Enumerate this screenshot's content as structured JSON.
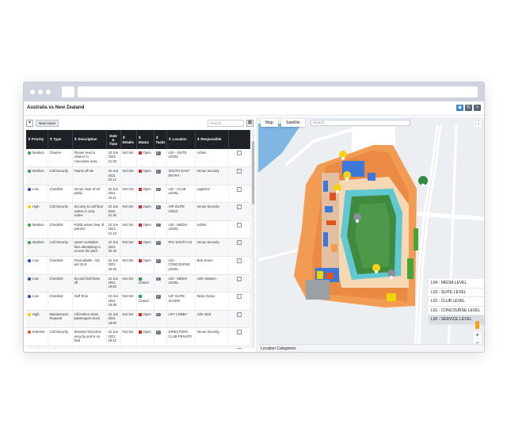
{
  "page": {
    "title": "Australia vs New Zealand"
  },
  "toolbar": {
    "filter_icon": "filter-icon",
    "new_issue_label": "New Issue",
    "search_placeholder": "Search"
  },
  "table": {
    "headers": [
      "Priority",
      "Type",
      "Description",
      "Date & Time",
      "Details",
      "Status",
      "Tasks",
      "Location",
      "Responsible"
    ],
    "rows": [
      {
        "priority": "Medium",
        "pcolor": "#2ea44f",
        "type": "Cleaner",
        "description": "Please send a cleaner to concourse area.",
        "datetime": "23 Jun 2021 21:20",
        "details": "Not Set",
        "status": "Open",
        "scolor": "#d62b2b",
        "tasks": "0",
        "location": "L03 - SUITE LEVEL",
        "responsible": "Admin"
      },
      {
        "priority": "Medium",
        "pcolor": "#2ea44f",
        "type": "Call Security",
        "description": "Teams off ele",
        "datetime": "22 Jun 2021 22:11",
        "details": "Not Set",
        "status": "Open",
        "scolor": "#d62b2b",
        "tasks": "0",
        "location": "SOUTH EAST ENTRY",
        "responsible": "Venue Security"
      },
      {
        "priority": "Low",
        "pcolor": "#2346c8",
        "type": "Checklist",
        "description": "Venue clear of all public",
        "datetime": "22 Jun 2021 22:11",
        "details": "Not Set",
        "status": "Open",
        "scolor": "#d62b2b",
        "tasks": "0",
        "location": "L02 - CLUB LEVEL",
        "responsible": "Logistics"
      },
      {
        "priority": "High",
        "pcolor": "#f0d400",
        "type": "Call Security",
        "description": "Security to call final orders in corp. suites",
        "datetime": "22 Jun 2021 21:30",
        "details": "Not Set",
        "status": "Open",
        "scolor": "#d62b2b",
        "tasks": "0",
        "location": "AIR SUITE GOLD",
        "responsible": "Venue Security"
      },
      {
        "priority": "Medium",
        "pcolor": "#2ea44f",
        "type": "Checklist",
        "description": "Public areas clear of patrons",
        "datetime": "22 Jun 2021 21:10",
        "details": "Not Set",
        "status": "Open",
        "scolor": "#d62b2b",
        "tasks": "0",
        "location": "L04 - MEDIA LEVEL",
        "responsible": "Admin"
      },
      {
        "priority": "Medium",
        "pcolor": "#2ea44f",
        "type": "Call Security",
        "description": "Upset Australian fans attempting to access the pitch",
        "datetime": "22 Jun 2021 20:46",
        "details": "Not Set",
        "status": "Open",
        "scolor": "#d62b2b",
        "tasks": "0",
        "location": "PAV SOUTH 04",
        "responsible": "Venue Security"
      },
      {
        "priority": "Low",
        "pcolor": "#2346c8",
        "type": "Checklist",
        "description": "Final whistle - NZ win 22-9",
        "datetime": "22 Jun 2021 20:40",
        "details": "Not Set",
        "status": "Open",
        "scolor": "#d62b2b",
        "tasks": "0",
        "location": "L01 - CONCOURSE LEVEL",
        "responsible": "Bob Green"
      },
      {
        "priority": "Low",
        "pcolor": "#2346c8",
        "type": "Checklist",
        "description": "Second half kicks off",
        "datetime": "22 Jun 2021 19:50",
        "details": "Not Set",
        "status": "Closed",
        "scolor": "#2ea44f",
        "tasks": "0",
        "location": "L04 - MEDIA LEVEL",
        "responsible": "John Watson"
      },
      {
        "priority": "Low",
        "pcolor": "#2346c8",
        "type": "Checklist",
        "description": "Half Time",
        "datetime": "22 Jun 2021 19:48",
        "details": "Not Set",
        "status": "Closed",
        "scolor": "#2ea44f",
        "tasks": "0",
        "location": "12F SUITE SILVER",
        "responsible": "Nicky Grace"
      },
      {
        "priority": "High",
        "pcolor": "#f0d400",
        "type": "Maintenance Request",
        "description": "Lift broken down passengers stuck",
        "datetime": "22 Jun 2021 18:50",
        "details": "Not Set",
        "status": "Open",
        "scolor": "#d62b2b",
        "tasks": "0",
        "location": "LIFT LOBBY",
        "responsible": "John Bird"
      },
      {
        "priority": "Extreme",
        "pcolor": "#e0541f",
        "type": "Call Security",
        "description": "Streaker breaches security and is on field",
        "datetime": "22 Jun 2021 18:22",
        "details": "Not Set",
        "status": "Open",
        "scolor": "#d62b2b",
        "tasks": "0",
        "location": "DIRECTORS CLUB PRIVATE",
        "responsible": "Venue Security"
      },
      {
        "priority": "Medium",
        "pcolor": "#2ea44f",
        "type": "Call Security",
        "description": "Drunk patron needs removed",
        "datetime": "22 Jun 2021",
        "details": "Not Set",
        "status": "Open",
        "scolor": "#d62b2b",
        "tasks": "0",
        "location": "DIRECTORS CLUB",
        "responsible": "Venue Security"
      }
    ]
  },
  "map": {
    "tabs": [
      "Map",
      "Satellite"
    ],
    "search_placeholder": "Search",
    "levels": [
      "L04 - MEDIA LEVEL",
      "L03 - SUITE LEVEL",
      "L02 - CLUB LEVEL",
      "L01 - CONCOURSE LEVEL",
      "L00 - SERVICE LEVEL"
    ],
    "active_level": "L00 - SERVICE LEVEL",
    "streets": [
      "O'Connell St",
      "Victoria St",
      "O'Connell St",
      "Pope St"
    ],
    "location_categories_label": "Location Categories",
    "zoom_in": "+",
    "zoom_out": "−",
    "fullscreen_icon": "⛶"
  }
}
